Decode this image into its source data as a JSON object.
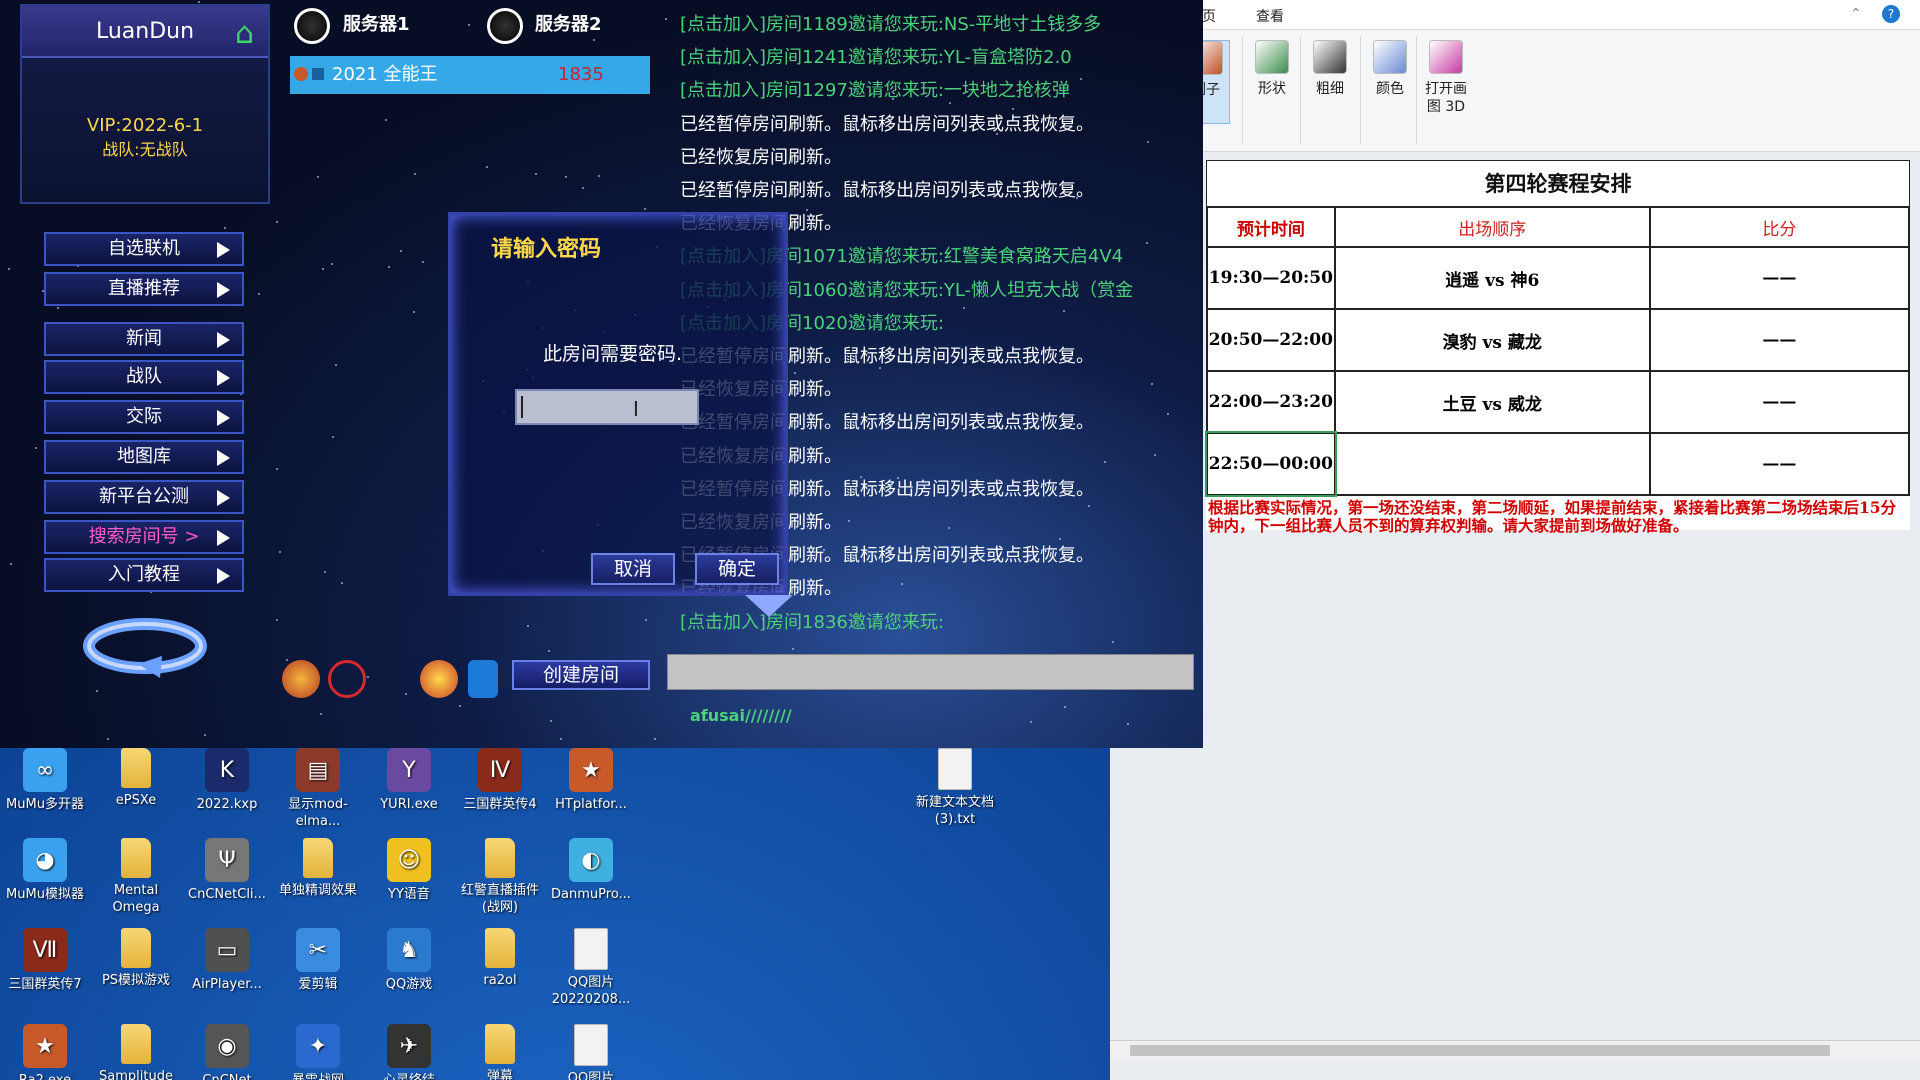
{
  "game": {
    "username": "LuanDun",
    "vip_text": "VIP:2022-6-1",
    "team_text": "战队:无战队",
    "servers": [
      "服务器1",
      "服务器2"
    ],
    "room": {
      "name": "2021 全能王",
      "count": "1835"
    },
    "menu": [
      "自选联机",
      "直播推荐",
      "新闻",
      "战队",
      "交际",
      "地图库",
      "新平台公测",
      "搜索房间号 >",
      "入门教程"
    ],
    "chat_lines": [
      {
        "kind": "join",
        "text": "[点击加入]房间1189邀请您来玩:NS-平地寸土钱多多"
      },
      {
        "kind": "join",
        "text": "[点击加入]房间1241邀请您来玩:YL-盲盒塔防2.0"
      },
      {
        "kind": "join",
        "text": "[点击加入]房间1297邀请您来玩:一块地之抢核弹"
      },
      {
        "kind": "sys",
        "text": "已经暂停房间刷新。鼠标移出房间列表或点我恢复。"
      },
      {
        "kind": "sys",
        "text": "已经恢复房间刷新。"
      },
      {
        "kind": "sys",
        "text": "已经暂停房间刷新。鼠标移出房间列表或点我恢复。"
      },
      {
        "kind": "sys",
        "text": "已经恢复房间刷新。"
      },
      {
        "kind": "join",
        "text": "[点击加入]房间1071邀请您来玩:红警美食窝路天启4V4"
      },
      {
        "kind": "join",
        "text": "[点击加入]房间1060邀请您来玩:YL-懒人坦克大战（赏金"
      },
      {
        "kind": "join",
        "text": "[点击加入]房间1020邀请您来玩:"
      },
      {
        "kind": "sys",
        "text": "已经暂停房间刷新。鼠标移出房间列表或点我恢复。"
      },
      {
        "kind": "sys",
        "text": "已经恢复房间刷新。"
      },
      {
        "kind": "sys",
        "text": "已经暂停房间刷新。鼠标移出房间列表或点我恢复。"
      },
      {
        "kind": "sys",
        "text": "已经恢复房间刷新。"
      },
      {
        "kind": "sys",
        "text": "已经暂停房间刷新。鼠标移出房间列表或点我恢复。"
      },
      {
        "kind": "sys",
        "text": "已经恢复房间刷新。"
      },
      {
        "kind": "sys",
        "text": "已经暂停房间刷新。鼠标移出房间列表或点我恢复。"
      },
      {
        "kind": "sys",
        "text": "已经恢复房间刷新。"
      },
      {
        "kind": "join",
        "text": "[点击加入]房间1836邀请您来玩:"
      }
    ],
    "dialog": {
      "title": "请输入密码",
      "message": "此房间需要密码.",
      "cancel": "取消",
      "ok": "确定"
    },
    "create_room": "创建房间",
    "footer_user": "afusai////////"
  },
  "paint": {
    "tab_partial": "页",
    "tab_view": "查看",
    "tools": [
      {
        "label": "工具",
        "icon": "tools-icon"
      },
      {
        "label": "刷子",
        "icon": "brush-icon",
        "active": true
      },
      {
        "label": "形状",
        "icon": "shapes-icon"
      },
      {
        "label": "粗细",
        "icon": "size-icon"
      },
      {
        "label": "颜色",
        "icon": "colors-icon"
      },
      {
        "label": "打开画图 3D",
        "icon": "paint3d-icon"
      }
    ],
    "schedule": {
      "title": "第四轮赛程安排",
      "headers": [
        "预计时间",
        "出场顺序",
        "比分"
      ],
      "rows": [
        [
          "19:30—20:50",
          "逍遥  vs  神6",
          "——"
        ],
        [
          "20:50—22:00",
          "溴豹  vs  藏龙",
          "——"
        ],
        [
          "22:00—23:20",
          "土豆  vs  威龙",
          "——"
        ],
        [
          "22:50—00:00",
          "",
          "——"
        ]
      ],
      "notice": "根据比赛实际情况，第一场还没结束，第二场顺延，如果提前结束，紧接着比赛第二场场结束后15分钟内，下一组比赛人员不到的算弃权判输。请大家提前到场做好准备。"
    }
  },
  "desktop": {
    "icons": [
      {
        "label": "MuMu多开器",
        "kind": "app",
        "color": "#3aa0f0",
        "glyph": "∞"
      },
      {
        "label": "ePSXe",
        "kind": "folder"
      },
      {
        "label": "2022.kxp",
        "kind": "app",
        "color": "#1a2a6a",
        "glyph": "K"
      },
      {
        "label": "显示mod-elma...",
        "kind": "app",
        "color": "#8c3b2a",
        "glyph": "▤"
      },
      {
        "label": "YURI.exe",
        "kind": "app",
        "color": "#6a4aa0",
        "glyph": "Y"
      },
      {
        "label": "三国群英传4",
        "kind": "app",
        "color": "#8a2a1a",
        "glyph": "Ⅳ"
      },
      {
        "label": "HTplatfor...",
        "kind": "app",
        "color": "#c85a2a",
        "glyph": "★"
      },
      {
        "label": "新建文本文档(3).txt",
        "kind": "file"
      },
      {
        "label": "MuMu模拟器",
        "kind": "app",
        "color": "#3aa0f0",
        "glyph": "◕"
      },
      {
        "label": "Mental Omega",
        "kind": "folder"
      },
      {
        "label": "CnCNetCli...",
        "kind": "app",
        "color": "#777777",
        "glyph": "Ψ"
      },
      {
        "label": "单独精调效果",
        "kind": "folder"
      },
      {
        "label": "YY语音",
        "kind": "app",
        "color": "#f0c020",
        "glyph": "☺"
      },
      {
        "label": "红警直播插件(战网)",
        "kind": "folder"
      },
      {
        "label": "DanmuPro...",
        "kind": "app",
        "color": "#40b0e0",
        "glyph": "◐"
      },
      {
        "label": "三国群英传7",
        "kind": "app",
        "color": "#8a2a1a",
        "glyph": "Ⅶ"
      },
      {
        "label": "PS模拟游戏",
        "kind": "folder"
      },
      {
        "label": "AirPlayer...",
        "kind": "app",
        "color": "#505050",
        "glyph": "▭"
      },
      {
        "label": "爱剪辑",
        "kind": "app",
        "color": "#3a8ce0",
        "glyph": "✂"
      },
      {
        "label": "QQ游戏",
        "kind": "app",
        "color": "#2a7ad0",
        "glyph": "♞"
      },
      {
        "label": "ra2ol",
        "kind": "folder"
      },
      {
        "label": "QQ图片20220208...",
        "kind": "file"
      },
      {
        "label": "Ra2.exe",
        "kind": "app",
        "color": "#c85a2a",
        "glyph": "★"
      },
      {
        "label": "Samplitude",
        "kind": "folder"
      },
      {
        "label": "CnCNet",
        "kind": "app",
        "color": "#555555",
        "glyph": "◉"
      },
      {
        "label": "暴雪战网",
        "kind": "app",
        "color": "#2a6ad0",
        "glyph": "✦"
      },
      {
        "label": "心灵终结",
        "kind": "app",
        "color": "#333333",
        "glyph": "✈"
      },
      {
        "label": "弹幕",
        "kind": "folder"
      },
      {
        "label": "QQ图片",
        "kind": "file"
      }
    ]
  }
}
